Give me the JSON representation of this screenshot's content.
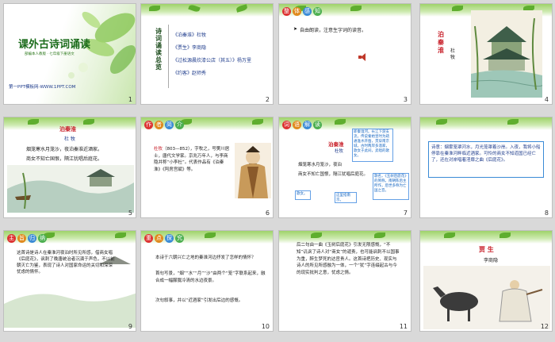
{
  "slides": [
    {
      "num": "1",
      "title": "课外古诗词诵读",
      "subtitle": "部编本人教版 · 七年级下册语文",
      "footer": "第一PPT模板网-WWW.1PPT.COM"
    },
    {
      "num": "2",
      "vertical_title": "诗词诵读总览",
      "items": [
        "《泊秦淮》杜牧",
        "《贾生》李商隐",
        "《过松源晨炊漆公店（其五）》杨万里",
        "《约客》赵师秀"
      ]
    },
    {
      "num": "3",
      "tag": [
        "整",
        "体",
        "感",
        "知"
      ],
      "text": "自由朗读，注意生字词的读音。"
    },
    {
      "num": "4",
      "title": "泊秦淮",
      "author": "杜 牧"
    },
    {
      "num": "5",
      "title": "泊秦淮",
      "author": "杜 牧",
      "lines": [
        "烟笼寒水月笼沙，夜泊秦淮近酒家。",
        "商女不知亡国恨，隔江犹唱后庭花。"
      ]
    },
    {
      "num": "6",
      "tag": [
        "作",
        "者",
        "简",
        "介"
      ],
      "bio_name": "杜牧",
      "bio": "（803—852），字牧之，号樊川居士，唐代文学家。京兆万年人，与李商隐并称“小李杜”。代表作品有《泊秦淮》《阿房宫赋》等。"
    },
    {
      "num": "7",
      "tag": [
        "词",
        "语",
        "解",
        "读"
      ],
      "title": "泊秦淮",
      "author": "杜牧",
      "poem": [
        "烟笼寒水月笼沙，夜泊",
        "商女不知亡国恨，隔江犹唱后庭花。"
      ],
      "note1": "即秦淮河。长江下游支流，传说秦始皇时为疏通淮水开凿，贯穿南京城，古时两岸多酒家，歌女于此间，卖唱的歌女。",
      "note2": "歌名，《玉树后庭花》的简称。南朝陈后主所作，后世多称为亡国之音。",
      "note3": "歌女。",
      "note4": "这里指南京。"
    },
    {
      "num": "8",
      "poem_text": "诗意：烟雾笼罩河水，月光笼罩着沙岸。入夜，我将小船停靠在秦淮河畔临近酒家。可怜的商女不知道国已经亡了，还在对岸唱着淫靡之曲《后庭花》。"
    },
    {
      "num": "9",
      "tag": [
        "主",
        "旨",
        "归",
        "纳"
      ],
      "text": "这首诗是诗人在秦淮河夜泊时所见所感，借商女唱《后庭花》，讽刺了晚唐统治者沉湎于声色，不以前朝灭亡为鉴，表现了诗人对国家命运的关切和深深忧虑的情怀。"
    },
    {
      "num": "10",
      "tag": [
        "重",
        "点",
        "探",
        "究"
      ],
      "q": "本诗于六朝兴亡之地的秦淮河边抒发了怎样的情怀？",
      "a1": "首句写景，“烟”“水”“月”“沙”由两个“笼”字联系起来，融合成一幅朦胧冷清的水边夜景。",
      "a2": "次句叙事，并以“近酒家”引发出后边的感慨。"
    },
    {
      "num": "11",
      "text": "后二句由一曲《玉树后庭花》引发无限感慨，“不知”讥讽了诗人对“商女”的谴责，也可能讽刺不以国事为重，醉生梦死的达官贵人。这首诗把历史、现实与诗人的所见所感融为一体，一个“犹”字连缀起古与今的现实批判之意，忧虑之情。"
    },
    {
      "num": "12",
      "title": "贾 生",
      "author": "李商隐"
    }
  ],
  "colors": {
    "red": "#c8202a",
    "blue": "#1f3c8c",
    "green": "#5fae2f",
    "panel": "#d9d9d9"
  }
}
